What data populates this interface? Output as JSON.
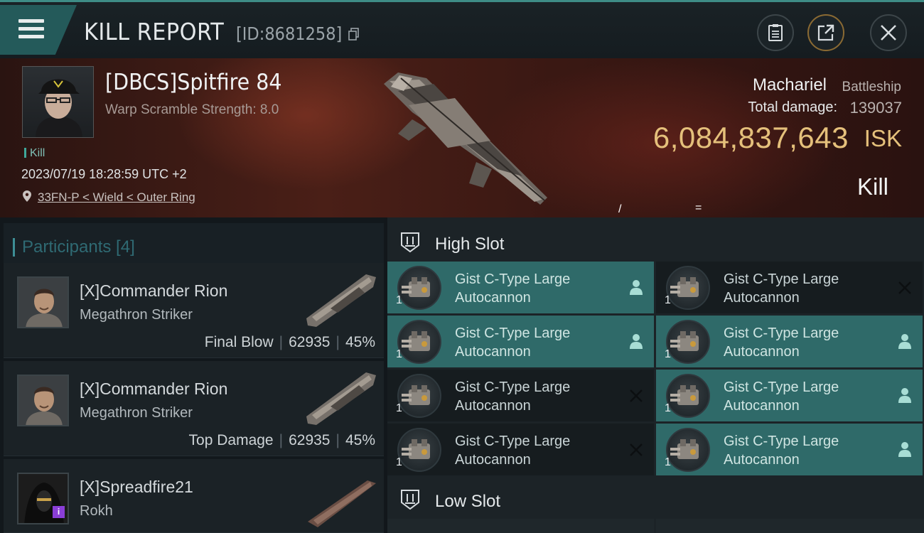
{
  "header": {
    "title": "KILL REPORT",
    "report_id": "[ID:8681258]",
    "menu_icon": "hamburger-menu-icon",
    "actions": [
      "clipboard-icon",
      "share-icon",
      "close-icon"
    ],
    "accent_color": "#3e8c86"
  },
  "victim": {
    "name": "[DBCS]Spitfire 84",
    "scramble": "Warp Scramble Strength: 8.0",
    "tag": "Kill",
    "date": "2023/07/19 18:28:59 UTC +2",
    "location": "33FN-P < Wield < Outer Ring",
    "ship_name": "Machariel",
    "ship_class": "Battleship",
    "damage_label": "Total damage:",
    "damage_value": "139037",
    "isk_value": "6,084,837,643",
    "isk_unit": "ISK",
    "result": "Kill",
    "mark_slash": "/",
    "mark_eq": "=",
    "isk_color": "#e5c07b"
  },
  "participants": {
    "title": "Participants [4]",
    "items": [
      {
        "name": "[X]Commander Rion",
        "ship": "Megathron Striker",
        "role": "Final Blow",
        "damage": "62935",
        "percent": "45%"
      },
      {
        "name": "[X]Commander Rion",
        "ship": "Megathron Striker",
        "role": "Top Damage",
        "damage": "62935",
        "percent": "45%"
      },
      {
        "name": "[X]Spreadfire21",
        "ship": "Rokh",
        "badge": "i"
      }
    ]
  },
  "fitting": {
    "high_slot_title": "High Slot",
    "low_slot_title": "Low Slot",
    "modules": [
      {
        "line1": "Gist C-Type Large",
        "line2": "Autocannon",
        "qty": "1",
        "status": "dropped",
        "status_icon": "person-icon"
      },
      {
        "line1": "Gist C-Type Large",
        "line2": "Autocannon",
        "qty": "1",
        "status": "destroyed",
        "status_icon": "x-icon"
      },
      {
        "line1": "Gist C-Type Large",
        "line2": "Autocannon",
        "qty": "1",
        "status": "dropped",
        "status_icon": "person-icon"
      },
      {
        "line1": "Gist C-Type Large",
        "line2": "Autocannon",
        "qty": "1",
        "status": "dropped",
        "status_icon": "person-icon"
      },
      {
        "line1": "Gist C-Type Large",
        "line2": "Autocannon",
        "qty": "1",
        "status": "destroyed",
        "status_icon": "x-icon"
      },
      {
        "line1": "Gist C-Type Large",
        "line2": "Autocannon",
        "qty": "1",
        "status": "dropped",
        "status_icon": "person-icon"
      },
      {
        "line1": "Gist C-Type Large",
        "line2": "Autocannon",
        "qty": "1",
        "status": "destroyed",
        "status_icon": "x-icon"
      },
      {
        "line1": "Gist C-Type Large",
        "line2": "Autocannon",
        "qty": "1",
        "status": "dropped",
        "status_icon": "person-icon"
      }
    ]
  }
}
